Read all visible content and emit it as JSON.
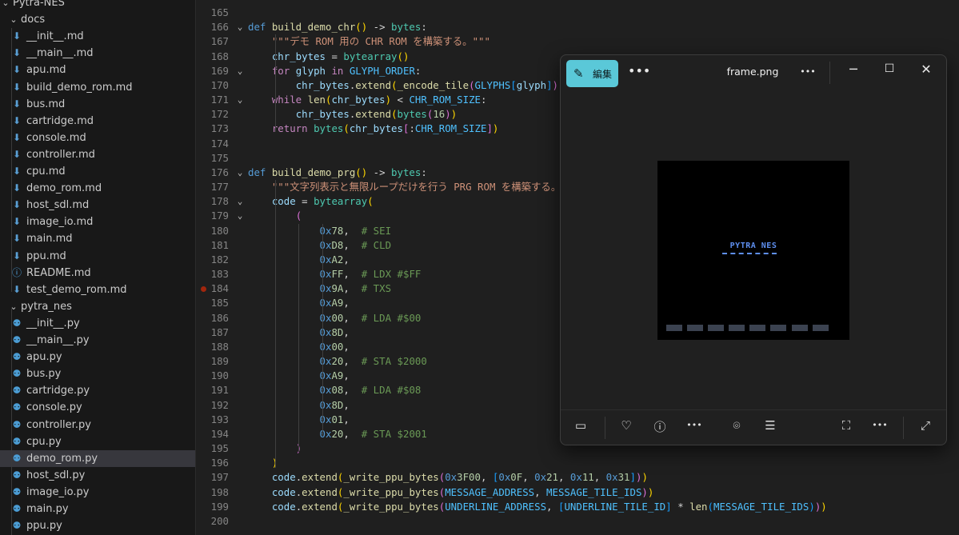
{
  "explorer": {
    "rows": [
      {
        "label": "Pytra-NES",
        "kind": "folder-open"
      },
      {
        "label": "docs",
        "kind": "folder-open"
      },
      {
        "label": "__init__.md",
        "kind": "md"
      },
      {
        "label": "__main__.md",
        "kind": "md"
      },
      {
        "label": "apu.md",
        "kind": "md"
      },
      {
        "label": "build_demo_rom.md",
        "kind": "md"
      },
      {
        "label": "bus.md",
        "kind": "md"
      },
      {
        "label": "cartridge.md",
        "kind": "md"
      },
      {
        "label": "console.md",
        "kind": "md"
      },
      {
        "label": "controller.md",
        "kind": "md"
      },
      {
        "label": "cpu.md",
        "kind": "md"
      },
      {
        "label": "demo_rom.md",
        "kind": "md"
      },
      {
        "label": "host_sdl.md",
        "kind": "md"
      },
      {
        "label": "image_io.md",
        "kind": "md"
      },
      {
        "label": "main.md",
        "kind": "md"
      },
      {
        "label": "ppu.md",
        "kind": "md"
      },
      {
        "label": "README.md",
        "kind": "info"
      },
      {
        "label": "test_demo_rom.md",
        "kind": "md"
      },
      {
        "label": "pytra_nes",
        "kind": "folder-open"
      },
      {
        "label": "__init__.py",
        "kind": "py"
      },
      {
        "label": "__main__.py",
        "kind": "py"
      },
      {
        "label": "apu.py",
        "kind": "py"
      },
      {
        "label": "bus.py",
        "kind": "py"
      },
      {
        "label": "cartridge.py",
        "kind": "py"
      },
      {
        "label": "console.py",
        "kind": "py"
      },
      {
        "label": "controller.py",
        "kind": "py"
      },
      {
        "label": "cpu.py",
        "kind": "py"
      },
      {
        "label": "demo_rom.py",
        "kind": "py",
        "selected": true
      },
      {
        "label": "host_sdl.py",
        "kind": "py"
      },
      {
        "label": "image_io.py",
        "kind": "py"
      },
      {
        "label": "main.py",
        "kind": "py"
      },
      {
        "label": "ppu.py",
        "kind": "py"
      }
    ]
  },
  "editor": {
    "lines": [
      {
        "n": "165",
        "t": []
      },
      {
        "n": "166",
        "fold": true,
        "t": [
          [
            "kw",
            "def "
          ],
          [
            "fn",
            "build_demo_chr"
          ],
          [
            "br1",
            "()"
          ],
          [
            "pl",
            " -> "
          ],
          [
            "ty",
            "bytes"
          ],
          [
            "pl",
            ":"
          ]
        ]
      },
      {
        "n": "167",
        "t": [
          [
            "pl",
            "    "
          ],
          [
            "str",
            "\"\"\"デモ ROM 用の CHR ROM を構築する。\"\"\""
          ]
        ]
      },
      {
        "n": "168",
        "t": [
          [
            "pl",
            "    "
          ],
          [
            "var",
            "chr_bytes"
          ],
          [
            "pl",
            " = "
          ],
          [
            "ty",
            "bytearray"
          ],
          [
            "br1",
            "()"
          ]
        ]
      },
      {
        "n": "169",
        "fold": true,
        "t": [
          [
            "pl",
            "    "
          ],
          [
            "kw2",
            "for "
          ],
          [
            "var",
            "glyph"
          ],
          [
            "kw2",
            " in "
          ],
          [
            "cst",
            "GLYPH_ORDER"
          ],
          [
            "pl",
            ":"
          ]
        ]
      },
      {
        "n": "170",
        "t": [
          [
            "pl",
            "        "
          ],
          [
            "var",
            "chr_bytes"
          ],
          [
            "pl",
            "."
          ],
          [
            "fn",
            "extend"
          ],
          [
            "br1",
            "("
          ],
          [
            "fn",
            "_encode_tile"
          ],
          [
            "br2",
            "("
          ],
          [
            "cst",
            "GLYPHS"
          ],
          [
            "br3",
            "["
          ],
          [
            "var",
            "glyph"
          ],
          [
            "br3",
            "]"
          ],
          [
            "br2",
            ")"
          ],
          [
            "br1",
            ")"
          ]
        ]
      },
      {
        "n": "171",
        "fold": true,
        "t": [
          [
            "pl",
            "    "
          ],
          [
            "kw2",
            "while "
          ],
          [
            "fn",
            "len"
          ],
          [
            "br1",
            "("
          ],
          [
            "var",
            "chr_bytes"
          ],
          [
            "br1",
            ")"
          ],
          [
            "pl",
            " < "
          ],
          [
            "cst",
            "CHR_ROM_SIZE"
          ],
          [
            "pl",
            ":"
          ]
        ]
      },
      {
        "n": "172",
        "t": [
          [
            "pl",
            "        "
          ],
          [
            "var",
            "chr_bytes"
          ],
          [
            "pl",
            "."
          ],
          [
            "fn",
            "extend"
          ],
          [
            "br1",
            "("
          ],
          [
            "ty",
            "bytes"
          ],
          [
            "br2",
            "("
          ],
          [
            "num",
            "16"
          ],
          [
            "br2",
            ")"
          ],
          [
            "br1",
            ")"
          ]
        ]
      },
      {
        "n": "173",
        "t": [
          [
            "pl",
            "    "
          ],
          [
            "kw2",
            "return "
          ],
          [
            "ty",
            "bytes"
          ],
          [
            "br1",
            "("
          ],
          [
            "var",
            "chr_bytes"
          ],
          [
            "br2",
            "["
          ],
          [
            "pl",
            ":"
          ],
          [
            "cst",
            "CHR_ROM_SIZE"
          ],
          [
            "br2",
            "]"
          ],
          [
            "br1",
            ")"
          ]
        ]
      },
      {
        "n": "174",
        "t": []
      },
      {
        "n": "175",
        "t": []
      },
      {
        "n": "176",
        "fold": true,
        "t": [
          [
            "kw",
            "def "
          ],
          [
            "fn",
            "build_demo_prg"
          ],
          [
            "br1",
            "()"
          ],
          [
            "pl",
            " -> "
          ],
          [
            "ty",
            "bytes"
          ],
          [
            "pl",
            ":"
          ]
        ]
      },
      {
        "n": "177",
        "t": [
          [
            "pl",
            "    "
          ],
          [
            "str",
            "\"\"\"文字列表示と無限ループだけを行う PRG ROM を構築する。\"\"\""
          ]
        ]
      },
      {
        "n": "178",
        "fold": true,
        "t": [
          [
            "pl",
            "    "
          ],
          [
            "var",
            "code"
          ],
          [
            "pl",
            " = "
          ],
          [
            "ty",
            "bytearray"
          ],
          [
            "br1",
            "("
          ]
        ]
      },
      {
        "n": "179",
        "fold": true,
        "t": [
          [
            "pl",
            "        "
          ],
          [
            "br2",
            "("
          ]
        ]
      },
      {
        "n": "180",
        "t": [
          [
            "pl",
            "            "
          ],
          [
            "kw",
            "0x"
          ],
          [
            "num",
            "78"
          ],
          [
            "pl",
            ",  "
          ],
          [
            "cm",
            "# SEI"
          ]
        ]
      },
      {
        "n": "181",
        "t": [
          [
            "pl",
            "            "
          ],
          [
            "kw",
            "0x"
          ],
          [
            "num",
            "D8"
          ],
          [
            "pl",
            ",  "
          ],
          [
            "cm",
            "# CLD"
          ]
        ]
      },
      {
        "n": "182",
        "t": [
          [
            "pl",
            "            "
          ],
          [
            "kw",
            "0x"
          ],
          [
            "num",
            "A2"
          ],
          [
            "pl",
            ","
          ]
        ]
      },
      {
        "n": "183",
        "t": [
          [
            "pl",
            "            "
          ],
          [
            "kw",
            "0x"
          ],
          [
            "num",
            "FF"
          ],
          [
            "pl",
            ",  "
          ],
          [
            "cm",
            "# LDX #$FF"
          ]
        ]
      },
      {
        "n": "184",
        "bp": true,
        "t": [
          [
            "pl",
            "            "
          ],
          [
            "kw",
            "0x"
          ],
          [
            "num",
            "9A"
          ],
          [
            "pl",
            ",  "
          ],
          [
            "cm",
            "# TXS"
          ]
        ]
      },
      {
        "n": "185",
        "t": [
          [
            "pl",
            "            "
          ],
          [
            "kw",
            "0x"
          ],
          [
            "num",
            "A9"
          ],
          [
            "pl",
            ","
          ]
        ]
      },
      {
        "n": "186",
        "t": [
          [
            "pl",
            "            "
          ],
          [
            "kw",
            "0x"
          ],
          [
            "num",
            "00"
          ],
          [
            "pl",
            ",  "
          ],
          [
            "cm",
            "# LDA #$00"
          ]
        ]
      },
      {
        "n": "187",
        "t": [
          [
            "pl",
            "            "
          ],
          [
            "kw",
            "0x"
          ],
          [
            "num",
            "8D"
          ],
          [
            "pl",
            ","
          ]
        ]
      },
      {
        "n": "188",
        "t": [
          [
            "pl",
            "            "
          ],
          [
            "kw",
            "0x"
          ],
          [
            "num",
            "00"
          ],
          [
            "pl",
            ","
          ]
        ]
      },
      {
        "n": "189",
        "t": [
          [
            "pl",
            "            "
          ],
          [
            "kw",
            "0x"
          ],
          [
            "num",
            "20"
          ],
          [
            "pl",
            ",  "
          ],
          [
            "cm",
            "# STA $2000"
          ]
        ]
      },
      {
        "n": "190",
        "t": [
          [
            "pl",
            "            "
          ],
          [
            "kw",
            "0x"
          ],
          [
            "num",
            "A9"
          ],
          [
            "pl",
            ","
          ]
        ]
      },
      {
        "n": "191",
        "t": [
          [
            "pl",
            "            "
          ],
          [
            "kw",
            "0x"
          ],
          [
            "num",
            "08"
          ],
          [
            "pl",
            ",  "
          ],
          [
            "cm",
            "# LDA #$08"
          ]
        ]
      },
      {
        "n": "192",
        "t": [
          [
            "pl",
            "            "
          ],
          [
            "kw",
            "0x"
          ],
          [
            "num",
            "8D"
          ],
          [
            "pl",
            ","
          ]
        ]
      },
      {
        "n": "193",
        "t": [
          [
            "pl",
            "            "
          ],
          [
            "kw",
            "0x"
          ],
          [
            "num",
            "01"
          ],
          [
            "pl",
            ","
          ]
        ]
      },
      {
        "n": "194",
        "t": [
          [
            "pl",
            "            "
          ],
          [
            "kw",
            "0x"
          ],
          [
            "num",
            "20"
          ],
          [
            "pl",
            ",  "
          ],
          [
            "cm",
            "# STA $2001"
          ]
        ]
      },
      {
        "n": "195",
        "t": [
          [
            "pl",
            "        "
          ],
          [
            "br2",
            ")"
          ]
        ]
      },
      {
        "n": "196",
        "t": [
          [
            "pl",
            "    "
          ],
          [
            "br1",
            ")"
          ]
        ]
      },
      {
        "n": "197",
        "t": [
          [
            "pl",
            "    "
          ],
          [
            "var",
            "code"
          ],
          [
            "pl",
            "."
          ],
          [
            "fn",
            "extend"
          ],
          [
            "br1",
            "("
          ],
          [
            "fn",
            "_write_ppu_bytes"
          ],
          [
            "br2",
            "("
          ],
          [
            "kw",
            "0x"
          ],
          [
            "num",
            "3F00"
          ],
          [
            "pl",
            ", "
          ],
          [
            "br3",
            "["
          ],
          [
            "kw",
            "0x"
          ],
          [
            "num",
            "0F"
          ],
          [
            "pl",
            ", "
          ],
          [
            "kw",
            "0x"
          ],
          [
            "num",
            "21"
          ],
          [
            "pl",
            ", "
          ],
          [
            "kw",
            "0x"
          ],
          [
            "num",
            "11"
          ],
          [
            "pl",
            ", "
          ],
          [
            "kw",
            "0x"
          ],
          [
            "num",
            "31"
          ],
          [
            "br3",
            "]"
          ],
          [
            "br2",
            ")"
          ],
          [
            "br1",
            ")"
          ]
        ]
      },
      {
        "n": "198",
        "t": [
          [
            "pl",
            "    "
          ],
          [
            "var",
            "code"
          ],
          [
            "pl",
            "."
          ],
          [
            "fn",
            "extend"
          ],
          [
            "br1",
            "("
          ],
          [
            "fn",
            "_write_ppu_bytes"
          ],
          [
            "br2",
            "("
          ],
          [
            "cst",
            "MESSAGE_ADDRESS"
          ],
          [
            "pl",
            ", "
          ],
          [
            "cst",
            "MESSAGE_TILE_IDS"
          ],
          [
            "br2",
            ")"
          ],
          [
            "br1",
            ")"
          ]
        ]
      },
      {
        "n": "199",
        "t": [
          [
            "pl",
            "    "
          ],
          [
            "var",
            "code"
          ],
          [
            "pl",
            "."
          ],
          [
            "fn",
            "extend"
          ],
          [
            "br1",
            "("
          ],
          [
            "fn",
            "_write_ppu_bytes"
          ],
          [
            "br2",
            "("
          ],
          [
            "cst",
            "UNDERLINE_ADDRESS"
          ],
          [
            "pl",
            ", "
          ],
          [
            "br3",
            "["
          ],
          [
            "cst",
            "UNDERLINE_TILE_ID"
          ],
          [
            "br3",
            "]"
          ],
          [
            "pl",
            " * "
          ],
          [
            "fn",
            "len"
          ],
          [
            "br3",
            "("
          ],
          [
            "cst",
            "MESSAGE_TILE_IDS"
          ],
          [
            "br3",
            ")"
          ],
          [
            "br2",
            ")"
          ],
          [
            "br1",
            ")"
          ]
        ]
      },
      {
        "n": "200",
        "t": []
      }
    ]
  },
  "viewer": {
    "edit_label": "編集",
    "title": "frame.png",
    "frame_text": "PYTRA NES",
    "toolbar_icons": [
      "edit-icon",
      "more-icon",
      "more-icon",
      "minimize-icon",
      "maximize-icon",
      "close-icon"
    ],
    "bottom_icons": [
      "filmstrip-icon",
      "heart-icon",
      "info-icon",
      "more-icon",
      "scan-icon",
      "ocr-icon",
      "fit-icon",
      "more-icon",
      "fullscreen-icon"
    ]
  }
}
